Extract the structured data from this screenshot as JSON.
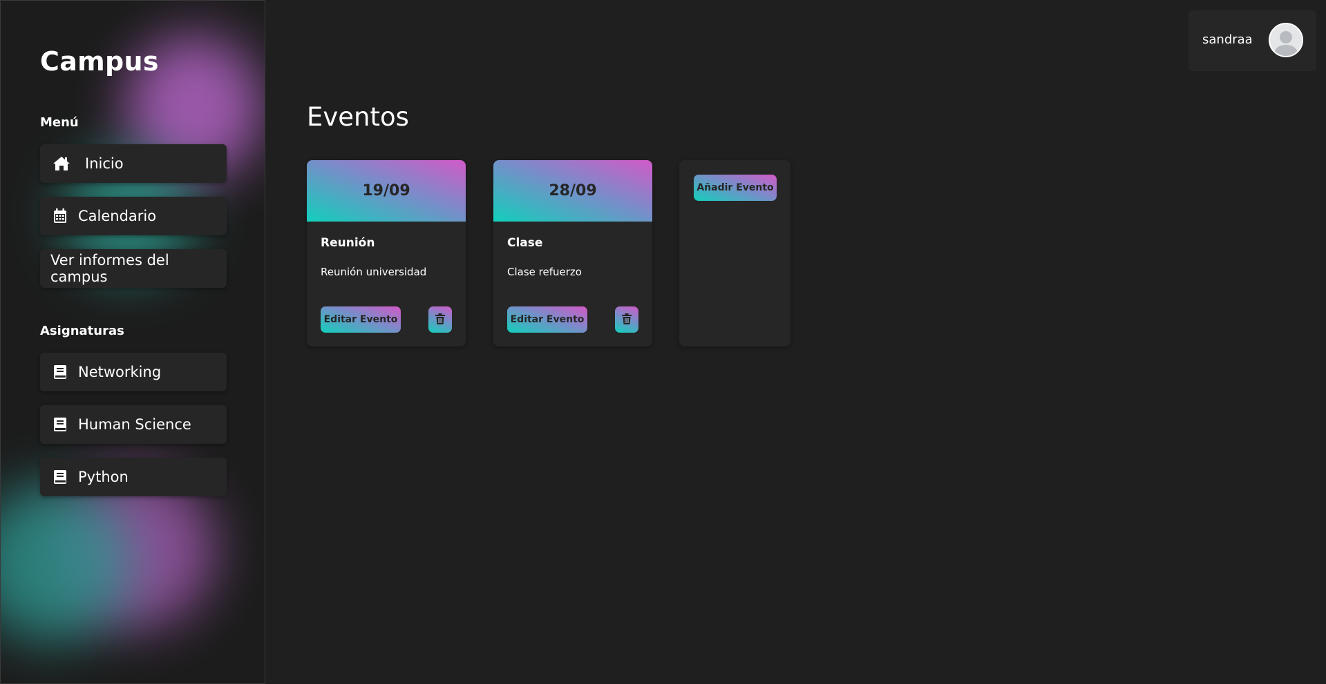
{
  "sidebar": {
    "brand": "Campus",
    "menu_title": "Menú",
    "menu_items": [
      {
        "label": "Inicio",
        "icon": "home-icon"
      },
      {
        "label": "Calendario",
        "icon": "calendar-icon"
      },
      {
        "label": "Ver informes del campus",
        "icon": ""
      }
    ],
    "subjects_title": "Asignaturas",
    "subjects": [
      {
        "label": "Networking",
        "icon": "book-icon"
      },
      {
        "label": "Human Science",
        "icon": "book-icon"
      },
      {
        "label": "Python",
        "icon": "book-icon"
      }
    ]
  },
  "header": {
    "username": "sandraa",
    "avatar_icon": "user-avatar-icon"
  },
  "main": {
    "title": "Eventos",
    "events": [
      {
        "date": "19/09",
        "title": "Reunión",
        "description": "Reunión universidad",
        "edit_label": "Editar Evento",
        "delete_icon": "trash-icon"
      },
      {
        "date": "28/09",
        "title": "Clase",
        "description": "Clase refuerzo",
        "edit_label": "Editar Evento",
        "delete_icon": "trash-icon"
      }
    ],
    "add_label": "Añadir Evento"
  },
  "colors": {
    "background": "#1f1f1f",
    "card": "#262626",
    "gradient_teal": "#12cfbb",
    "gradient_purple": "#d25ac8",
    "text": "#ffffff"
  }
}
